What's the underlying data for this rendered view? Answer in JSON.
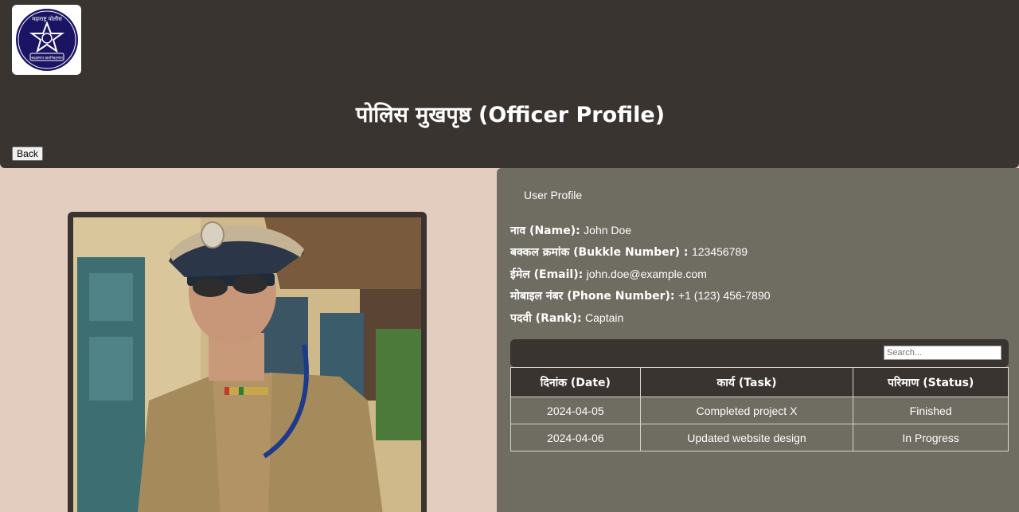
{
  "header": {
    "logo_text_top": "महाराष्ट्र पोलीस",
    "logo_text_bottom": "सद्रक्षणाय खलनिग्रहणाय",
    "title": "पोलिस मुखपृष्ठ (Officer Profile)",
    "back_label": "Back"
  },
  "colors": {
    "header_bg": "#3a3430",
    "page_bg": "#e2cdbf",
    "panel_bg": "#6f6c62",
    "logo_blue": "#1b1464"
  },
  "profile": {
    "heading": "User Profile",
    "fields": [
      {
        "label": "नाव (Name):",
        "value": "John Doe"
      },
      {
        "label": "बक्कल क्रमांक (Bukkle Number) :",
        "value": "123456789"
      },
      {
        "label": "ईमेल (Email):",
        "value": "john.doe@example.com"
      },
      {
        "label": "मोबाइल नंबर (Phone Number):",
        "value": "+1 (123) 456-7890"
      },
      {
        "label": "पदवी (Rank):",
        "value": "Captain"
      }
    ]
  },
  "search": {
    "placeholder": "Search..."
  },
  "table": {
    "columns": [
      "दिनांक (Date)",
      "कार्य (Task)",
      "परिमाण (Status)"
    ],
    "rows": [
      [
        "2024-04-05",
        "Completed project X",
        "Finished"
      ],
      [
        "2024-04-06",
        "Updated website design",
        "In Progress"
      ]
    ]
  }
}
